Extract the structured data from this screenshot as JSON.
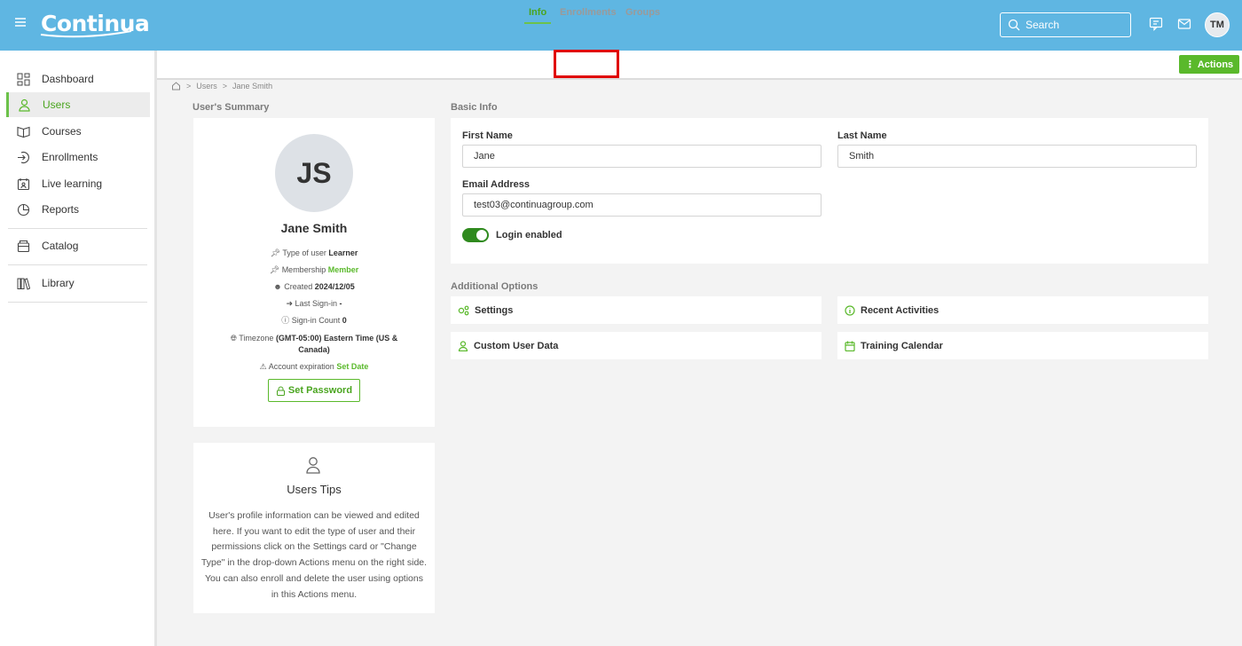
{
  "app": {
    "logo": "Continua"
  },
  "header": {
    "search_placeholder": "Search",
    "avatar_initials": "TM"
  },
  "sidebar": {
    "items": [
      {
        "label": "Dashboard",
        "icon": "dashboard-icon"
      },
      {
        "label": "Users",
        "icon": "user-icon",
        "active": true
      },
      {
        "label": "Courses",
        "icon": "book-icon"
      },
      {
        "label": "Enrollments",
        "icon": "enroll-icon"
      },
      {
        "label": "Live learning",
        "icon": "calendar-person-icon"
      },
      {
        "label": "Reports",
        "icon": "pie-chart-icon"
      },
      {
        "label": "Catalog",
        "icon": "catalog-icon"
      },
      {
        "label": "Library",
        "icon": "library-icon"
      }
    ]
  },
  "tabs": [
    {
      "label": "Info",
      "active": true
    },
    {
      "label": "Enrollments"
    },
    {
      "label": "Groups"
    }
  ],
  "actions_label": "Actions",
  "breadcrumb": [
    "Users",
    "Jane Smith"
  ],
  "summary": {
    "section_title": "User's Summary",
    "initials": "JS",
    "name": "Jane Smith",
    "type_label": "Type of user",
    "type_value": "Learner",
    "membership_label": "Membership",
    "membership_value": "Member",
    "created_label": "Created",
    "created_value": "2024/12/05",
    "last_signin_label": "Last Sign-in",
    "last_signin_value": "-",
    "signin_count_label": "Sign-in Count",
    "signin_count_value": "0",
    "timezone_label": "Timezone",
    "timezone_value": "(GMT-05:00) Eastern Time (US & Canada)",
    "expiration_label": "Account expiration",
    "expiration_value": "Set Date",
    "set_password_label": "Set Password"
  },
  "tips": {
    "title": "Users Tips",
    "body": "User's profile information can be viewed and edited here. If you want to edit the type of user and their permissions click on the Settings card or \"Change Type\" in the drop-down Actions menu on the right side. You can also enroll and delete the user using options in this Actions menu."
  },
  "basic_info": {
    "section_title": "Basic Info",
    "first_name_label": "First Name",
    "first_name_value": "Jane",
    "last_name_label": "Last Name",
    "last_name_value": "Smith",
    "email_label": "Email Address",
    "email_value": "test03@continuagroup.com",
    "login_label": "Login enabled",
    "login_enabled": true
  },
  "additional": {
    "section_title": "Additional Options",
    "settings": "Settings",
    "recent_activities": "Recent Activities",
    "custom_user_data": "Custom User Data",
    "training_calendar": "Training Calendar"
  },
  "colors": {
    "header": "#5fb6e2",
    "accent_green": "#5ab92b",
    "highlight_red": "#e00000"
  }
}
